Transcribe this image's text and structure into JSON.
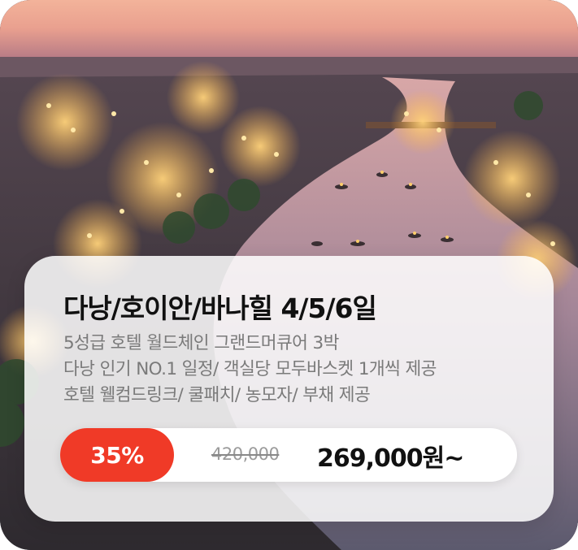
{
  "product": {
    "title": "다낭/호이안/바나힐 4/5/6일",
    "description_lines": [
      "5성급 호텔 월드체인 그랜드머큐어 3박",
      "다낭 인기 NO.1 일정/ 객실당 모두바스켓 1개씩 제공",
      "호텔 웰컴드링크/ 쿨패치/ 농모자/ 부채 제공"
    ],
    "price": {
      "discount": "35%",
      "original": "420,000",
      "sale": "269,000원~"
    }
  },
  "colors": {
    "discount_badge": "#f03a27",
    "title_text": "#111111",
    "description_text": "#7a7a7a",
    "panel_background": "#ffffff"
  }
}
